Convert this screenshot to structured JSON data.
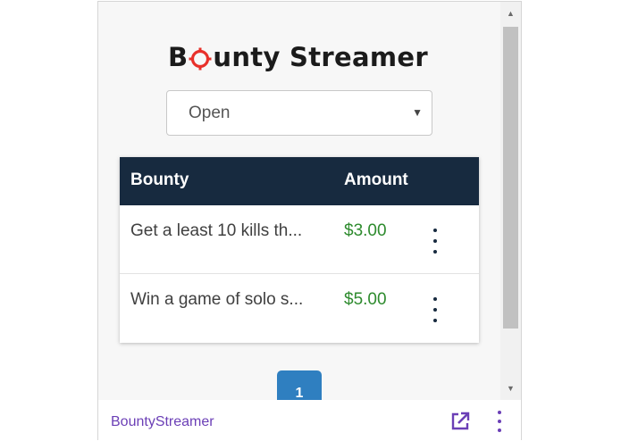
{
  "brand": {
    "logo_prefix": "B",
    "logo_suffix": "unty Streamer",
    "accent_color": "#e8302a"
  },
  "filter": {
    "selected": "Open"
  },
  "table": {
    "headers": {
      "bounty": "Bounty",
      "amount": "Amount"
    },
    "rows": [
      {
        "description": "Get a least 10 kills th...",
        "amount": "$3.00"
      },
      {
        "description": "Win a game of solo s...",
        "amount": "$5.00"
      }
    ]
  },
  "pagination": {
    "current_page": "1"
  },
  "footer": {
    "extension_name": "BountyStreamer",
    "icons": [
      "popout-icon",
      "more-options-icon"
    ]
  },
  "colors": {
    "header_bg": "#172a3f",
    "amount_text": "#2e8b2e",
    "page_button": "#2f7fc0",
    "footer_link": "#6b3fb6"
  }
}
